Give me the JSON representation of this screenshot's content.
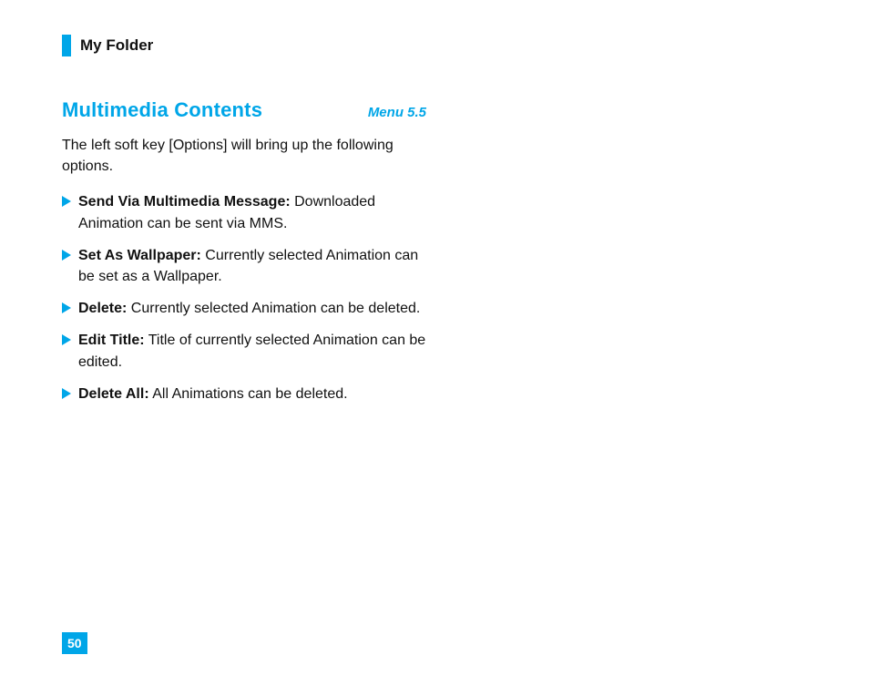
{
  "header": {
    "title": "My Folder"
  },
  "section": {
    "title": "Multimedia Contents",
    "menu_label": "Menu 5.5",
    "intro": "The left soft key [Options] will bring up the following options."
  },
  "bullets": [
    {
      "bold": "Send Via Multimedia Message:",
      "rest": " Downloaded Animation can be sent via MMS."
    },
    {
      "bold": "Set As Wallpaper:",
      "rest": " Currently selected Animation can be set as a Wallpaper."
    },
    {
      "bold": "Delete:",
      "rest": " Currently selected Animation can be deleted."
    },
    {
      "bold": "Edit Title:",
      "rest": " Title of currently selected Animation can be edited."
    },
    {
      "bold": "Delete All:",
      "rest": " All Animations can be deleted."
    }
  ],
  "page_number": "50",
  "colors": {
    "accent": "#00a6e8"
  }
}
